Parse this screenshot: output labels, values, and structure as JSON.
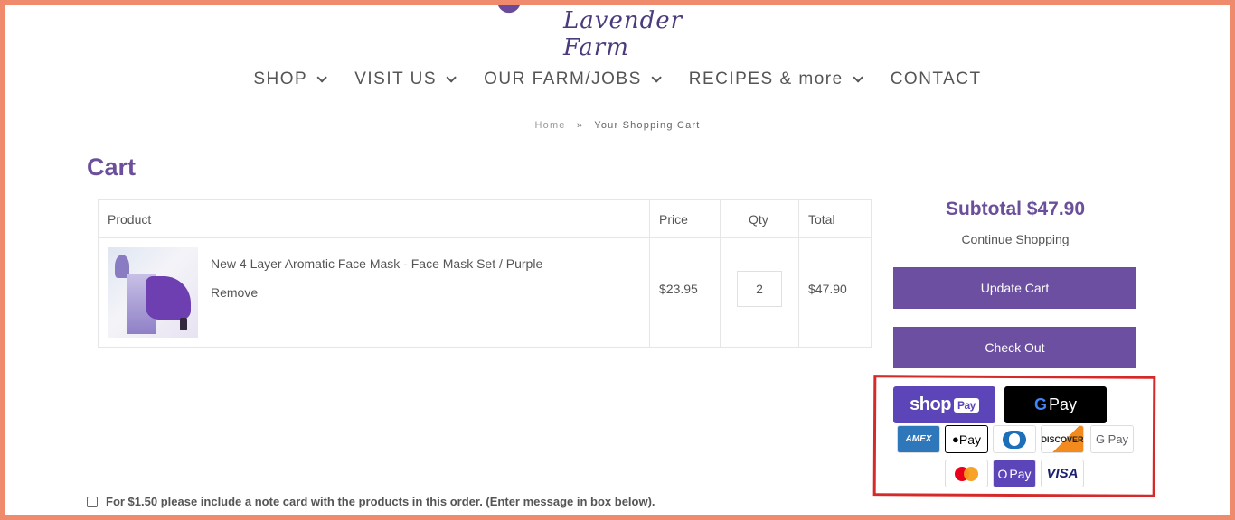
{
  "logo": {
    "script_text": "Lavender Farm"
  },
  "nav": [
    {
      "label": "SHOP"
    },
    {
      "label": "VISIT US"
    },
    {
      "label": "OUR FARM/JOBS"
    },
    {
      "label": "RECIPES & more"
    },
    {
      "label": "CONTACT"
    }
  ],
  "breadcrumb": {
    "home": "Home",
    "separator": "»",
    "current": "Your Shopping Cart"
  },
  "page_title": "Cart",
  "table": {
    "headers": {
      "product": "Product",
      "price": "Price",
      "qty": "Qty",
      "total": "Total"
    },
    "rows": [
      {
        "name": "New 4 Layer Aromatic Face Mask - Face Mask Set / Purple",
        "remove": "Remove",
        "price": "$23.95",
        "qty": "2",
        "total": "$47.90"
      }
    ]
  },
  "summary": {
    "subtotal": "Subtotal $47.90",
    "continue": "Continue Shopping",
    "update_cart": "Update Cart",
    "checkout": "Check Out"
  },
  "payment": {
    "shop_pay": {
      "word": "shop",
      "tag": "Pay"
    },
    "google_pay_button": {
      "g": "G",
      "word": "Pay"
    },
    "cards": {
      "amex": "AMEX",
      "apple_pay": " Pay",
      "discover": "DISCOVER",
      "google_pay": "G Pay",
      "o_pay": "Pay",
      "visa": "VISA"
    },
    "colors": {
      "accent": "#6c4fa0",
      "highlight": "#d62a2a"
    }
  },
  "note": {
    "label": "For $1.50 please include a note card with the products in this order. (Enter message in box below)."
  }
}
